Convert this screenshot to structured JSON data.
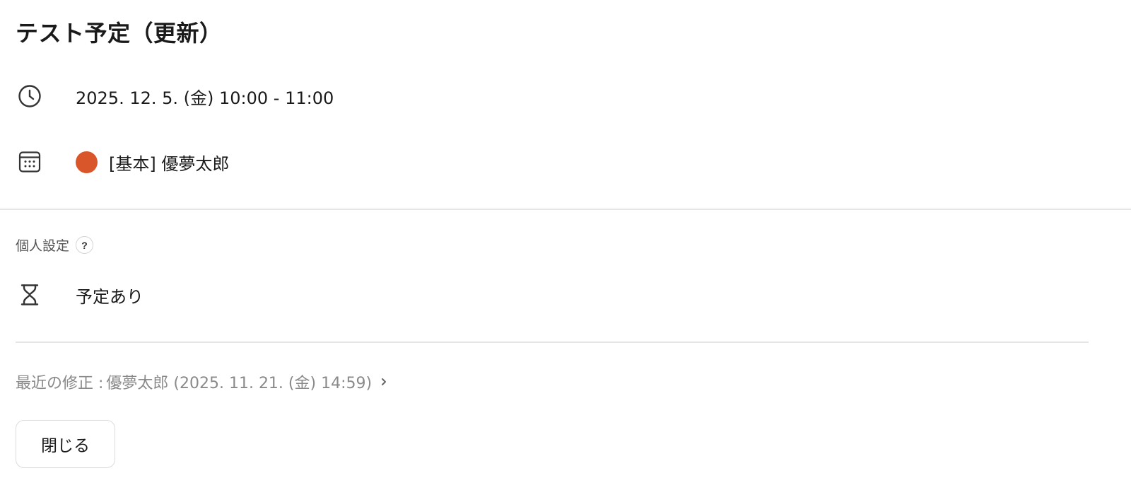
{
  "event": {
    "title": "テスト予定（更新）",
    "datetime": "2025. 12. 5. (金) 10:00 - 11:00",
    "calendar": {
      "label": "[基本] 優夢太郎",
      "color": "#d9562a"
    }
  },
  "personal_settings": {
    "label": "個人設定",
    "help_icon_text": "?",
    "status": "予定あり"
  },
  "modified": {
    "prefix": "最近の修正 :",
    "by_and_date": "優夢太郎 (2025. 11. 21. (金) 14:59)"
  },
  "actions": {
    "close_label": "閉じる"
  },
  "icons": {
    "time": "clock-icon",
    "calendar": "calendar-icon",
    "status": "hourglass-icon",
    "help": "question-icon",
    "link": "chevron-right-icon"
  },
  "colors": {
    "divider": "#e5e5e5",
    "muted_text": "#8a8a8a"
  }
}
